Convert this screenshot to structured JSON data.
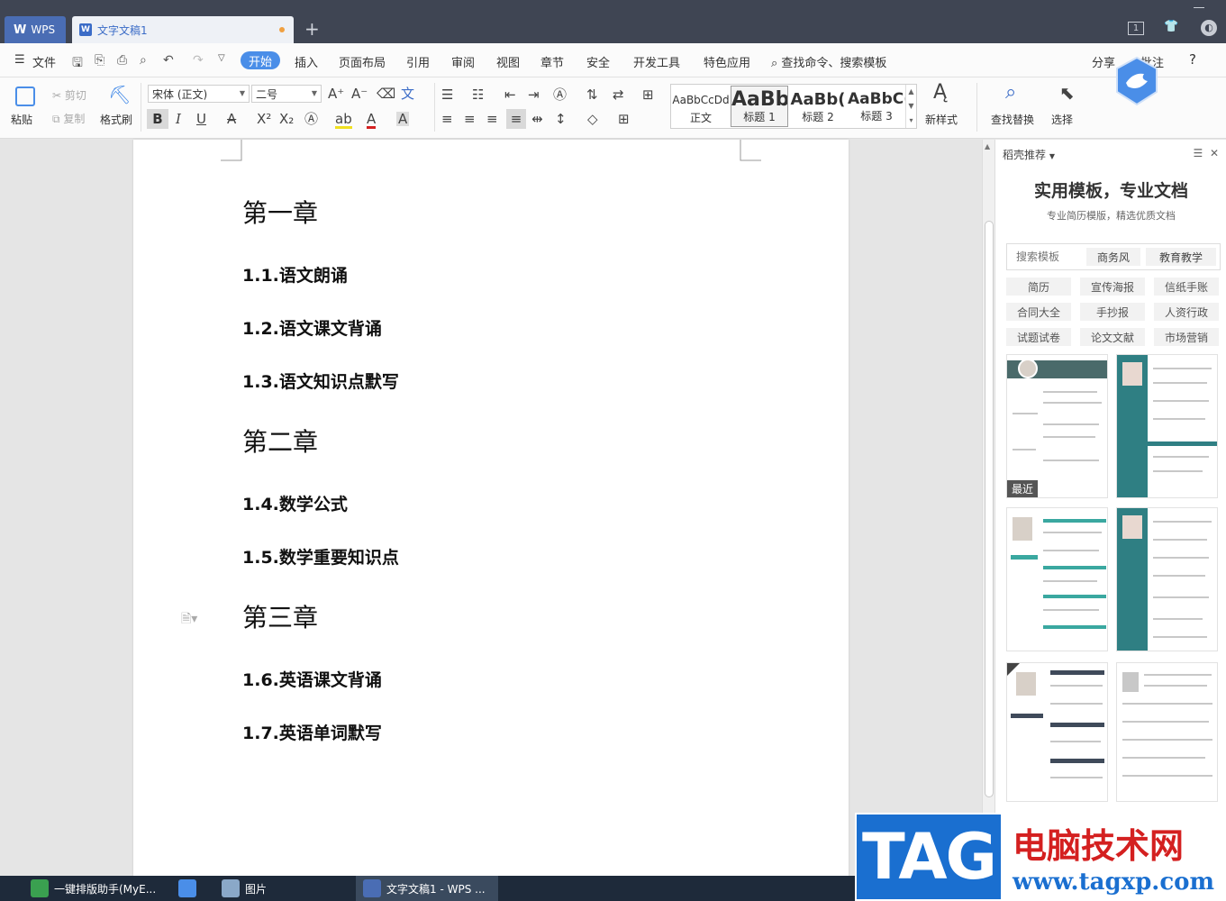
{
  "titlebar": {
    "app_tab": "WPS",
    "doc_tab": "文字文稿1",
    "new_tab": "+",
    "page_badge": "1"
  },
  "menubar": {
    "file": "文件",
    "items": [
      "开始",
      "插入",
      "页面布局",
      "引用",
      "审阅",
      "视图",
      "章节",
      "安全",
      "开发工具",
      "特色应用"
    ],
    "search": "查找命令、搜索模板",
    "share": "分享",
    "comment": "批注",
    "help": "?"
  },
  "ribbon": {
    "paste": "粘贴",
    "cut": "剪切",
    "copy": "复制",
    "format_painter": "格式刷",
    "font_name": "宋体 (正文)",
    "font_size": "二号",
    "styles": [
      {
        "sample": "AaBbCcDd",
        "name": "正文"
      },
      {
        "sample": "AaBb",
        "name": "标题 1"
      },
      {
        "sample": "AaBb(",
        "name": "标题 2"
      },
      {
        "sample": "AaBbC(",
        "name": "标题 3"
      }
    ],
    "new_style": "新样式",
    "find_replace": "查找替换",
    "select": "选择"
  },
  "document": {
    "chapters": [
      {
        "title": "第一章",
        "sections": [
          "1.1.语文朗诵",
          "1.2.语文课文背诵",
          "1.3.语文知识点默写"
        ]
      },
      {
        "title": "第二章",
        "sections": [
          "1.4.数学公式",
          "1.5.数学重要知识点"
        ]
      },
      {
        "title": "第三章",
        "sections": [
          "1.6.英语课文背诵",
          "1.7.英语单词默写"
        ]
      }
    ]
  },
  "sidepanel": {
    "header": "稻壳推荐",
    "title": "实用模板，专业文档",
    "subtitle": "专业简历模版，精选优质文档",
    "search_placeholder": "搜索模板",
    "tags": [
      "商务风",
      "教育教学"
    ],
    "categories": [
      "简历",
      "宣传海报",
      "信纸手账",
      "合同大全",
      "手抄报",
      "人资行政",
      "试题试卷",
      "论文文献",
      "市场营销"
    ],
    "recent_badge": "最近"
  },
  "taskbar": {
    "items": [
      "一键排版助手(MyE...",
      "",
      "图片",
      "文字文稿1 - WPS ..."
    ]
  },
  "watermark": {
    "tag": "TAG",
    "cn": "电脑技术网",
    "url": "www.tagxp.com"
  },
  "colors": {
    "accent": "#4a8ee8",
    "titlebar": "#3f4553",
    "teal": "#2f7f83",
    "watermark_red": "#d42020",
    "watermark_blue": "#1a6fd0"
  }
}
